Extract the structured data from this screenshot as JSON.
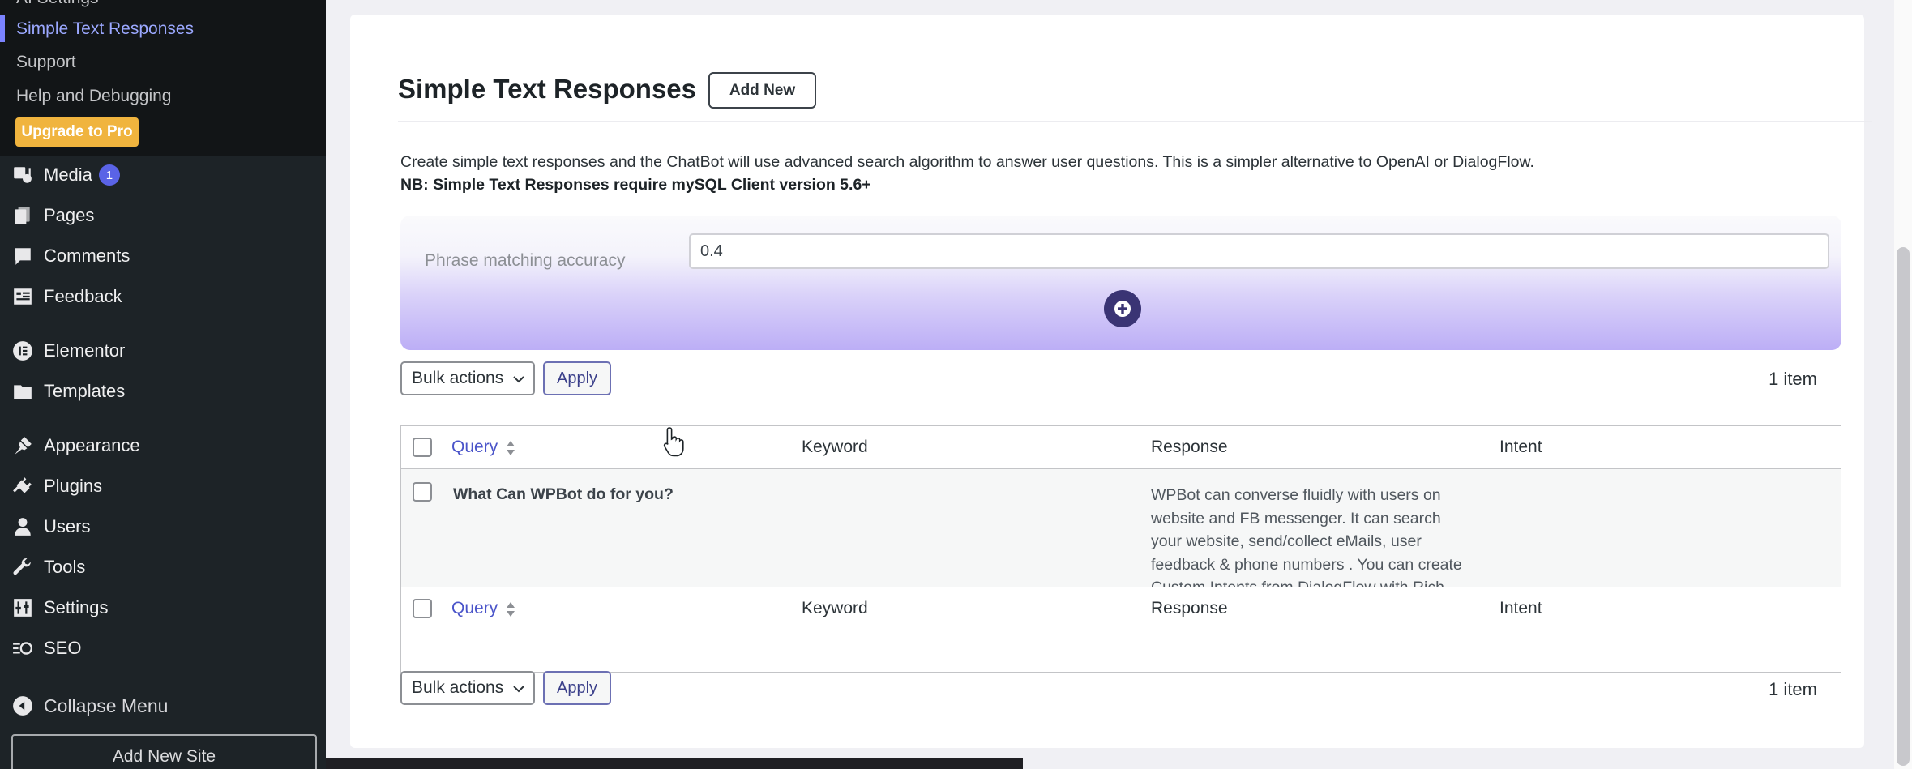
{
  "sidebar": {
    "submenu": {
      "partial_top_item": "AI Settings",
      "items": [
        {
          "label": "Simple Text Responses",
          "active": true
        },
        {
          "label": "Support",
          "active": false
        },
        {
          "label": "Help and Debugging",
          "active": false
        }
      ],
      "upgrade_label": "Upgrade to Pro"
    },
    "menu": [
      {
        "label": "Media",
        "icon": "media-icon",
        "badge": "1"
      },
      {
        "label": "Pages",
        "icon": "pages-icon"
      },
      {
        "label": "Comments",
        "icon": "comments-icon"
      },
      {
        "label": "Feedback",
        "icon": "feedback-icon"
      },
      {
        "label": "Elementor",
        "icon": "elementor-icon"
      },
      {
        "label": "Templates",
        "icon": "templates-icon"
      },
      {
        "label": "Appearance",
        "icon": "appearance-icon"
      },
      {
        "label": "Plugins",
        "icon": "plugins-icon"
      },
      {
        "label": "Users",
        "icon": "users-icon"
      },
      {
        "label": "Tools",
        "icon": "tools-icon"
      },
      {
        "label": "Settings",
        "icon": "settings-icon"
      },
      {
        "label": "SEO",
        "icon": "seo-icon"
      }
    ],
    "collapse_label": "Collapse Menu",
    "add_new_site_label": "Add New Site"
  },
  "header": {
    "title": "Simple Text Responses",
    "add_new_label": "Add New"
  },
  "description": {
    "text": "Create simple text responses and the ChatBot will use advanced search algorithm to answer user questions. This is a simpler alternative to OpenAI or DialogFlow.",
    "note": "NB: Simple Text Responses require mySQL Client version 5.6+"
  },
  "phrase": {
    "label": "Phrase matching accuracy",
    "value": "0.4"
  },
  "bulk": {
    "select_label": "Bulk actions",
    "apply_label": "Apply",
    "item_count": "1 item"
  },
  "table": {
    "columns": {
      "query": "Query",
      "keyword": "Keyword",
      "response": "Response",
      "intent": "Intent"
    },
    "rows": [
      {
        "query": "What Can WPBot do for you?",
        "keyword": "",
        "response": "WPBot can converse fluidly with users on\nwebsite and FB messenger. It can search\nyour website, send/collect eMails, user\nfeedback & phone numbers . You can create\nCustom Intents from DialogFlow with Rich\nMessages & Card responses!",
        "intent": ""
      }
    ]
  },
  "colors": {
    "accent": "#5a63e6",
    "sidebar_bg": "#1d2327",
    "upgrade": "#f0b43e",
    "plus_button": "#3a3474"
  }
}
